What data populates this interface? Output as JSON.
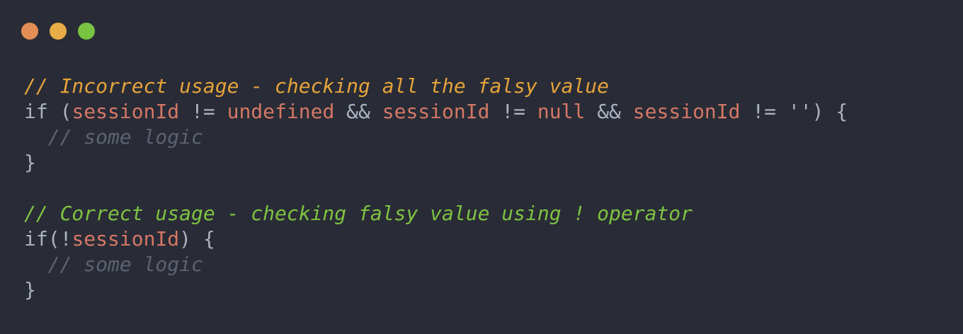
{
  "window": {
    "controls": {
      "close_color": "#e38e56",
      "minimize_color": "#e8ad46",
      "zoom_color": "#78c342"
    }
  },
  "code": {
    "lines": [
      {
        "tokens": [
          {
            "type": "comment-yellow",
            "text": "// Incorrect usage - checking all the falsy value"
          }
        ]
      },
      {
        "tokens": [
          {
            "type": "keyword",
            "text": "if "
          },
          {
            "type": "punct",
            "text": "("
          },
          {
            "type": "ident",
            "text": "sessionId"
          },
          {
            "type": "op",
            "text": " != "
          },
          {
            "type": "undef",
            "text": "undefined"
          },
          {
            "type": "op",
            "text": " && "
          },
          {
            "type": "ident",
            "text": "sessionId"
          },
          {
            "type": "op",
            "text": " != "
          },
          {
            "type": "null",
            "text": "null"
          },
          {
            "type": "op",
            "text": " && "
          },
          {
            "type": "ident",
            "text": "sessionId"
          },
          {
            "type": "op",
            "text": " != "
          },
          {
            "type": "str",
            "text": "''"
          },
          {
            "type": "punct",
            "text": ") {"
          }
        ]
      },
      {
        "tokens": [
          {
            "type": "comment",
            "text": "  // some logic"
          }
        ]
      },
      {
        "tokens": [
          {
            "type": "punct",
            "text": "}"
          }
        ]
      },
      {
        "tokens": []
      },
      {
        "tokens": [
          {
            "type": "comment-green",
            "text": "// Correct usage - checking falsy value using ! operator"
          }
        ]
      },
      {
        "tokens": [
          {
            "type": "keyword",
            "text": "if"
          },
          {
            "type": "punct",
            "text": "("
          },
          {
            "type": "op",
            "text": "!"
          },
          {
            "type": "ident",
            "text": "sessionId"
          },
          {
            "type": "punct",
            "text": ") {"
          }
        ]
      },
      {
        "tokens": [
          {
            "type": "comment",
            "text": "  // some logic"
          }
        ]
      },
      {
        "tokens": [
          {
            "type": "punct",
            "text": "}"
          }
        ]
      }
    ]
  }
}
